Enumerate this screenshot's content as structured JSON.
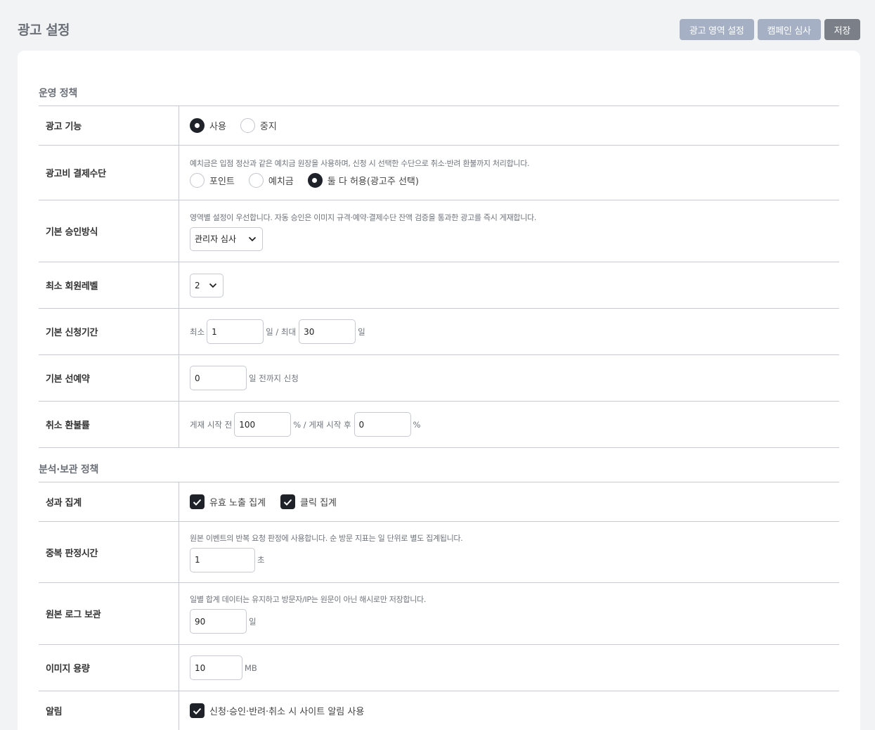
{
  "header": {
    "title": "광고 설정",
    "buttons": {
      "ad_area": "광고 영역 설정",
      "campaign_review": "캠페인 심사",
      "save": "저장"
    }
  },
  "operation": {
    "section_title": "운영 정책",
    "ad_feature": {
      "label": "광고 기능",
      "options": [
        "사용",
        "중지"
      ],
      "selected": "사용"
    },
    "payment": {
      "label": "광고비 결제수단",
      "help": "예치금은 입점 정산과 같은 예치금 원장을 사용하며, 신청 시 선택한 수단으로 취소·반려 환불까지 처리합니다.",
      "options": [
        "포인트",
        "예치금",
        "둘 다 허용(광고주 선택)"
      ],
      "selected": "둘 다 허용(광고주 선택)"
    },
    "approval": {
      "label": "기본 승인방식",
      "help": "영역별 설정이 우선합니다. 자동 승인은 이미지 규격·예약·결제수단 잔액 검증을 통과한 광고를 즉시 게재합니다.",
      "value": "관리자 심사"
    },
    "min_level": {
      "label": "최소 회원레벨",
      "value": "2"
    },
    "period": {
      "label": "기본 신청기간",
      "prefix": "최소",
      "min": "1",
      "mid": "일 / 최대",
      "max": "30",
      "suffix": "일"
    },
    "pre_booking": {
      "label": "기본 선예약",
      "value": "0",
      "suffix": "일 전까지 신청"
    },
    "refund": {
      "label": "취소 환불률",
      "prefix": "게재 시작 전",
      "before": "100",
      "mid": "% / 게재 시작 후",
      "after": "0",
      "suffix": "%"
    }
  },
  "analytics": {
    "section_title": "분석·보관 정책",
    "stats": {
      "label": "성과 집계",
      "options": [
        "유효 노출 집계",
        "클릭 집계"
      ]
    },
    "dedupe": {
      "label": "중복 판정시간",
      "help": "원본 이벤트의 반복 요청 판정에 사용합니다. 순 방문 지표는 일 단위로 별도 집계됩니다.",
      "value": "1",
      "suffix": "초"
    },
    "log_retention": {
      "label": "원본 로그 보관",
      "help": "일별 합계 데이터는 유지하고 방문자/IP는 원문이 아닌 해시로만 저장합니다.",
      "value": "90",
      "suffix": "일"
    },
    "image_size": {
      "label": "이미지 용량",
      "value": "10",
      "suffix": "MB"
    },
    "notify": {
      "label": "알림",
      "option": "신청·승인·반려·취소 시 사이트 알림 사용"
    }
  }
}
